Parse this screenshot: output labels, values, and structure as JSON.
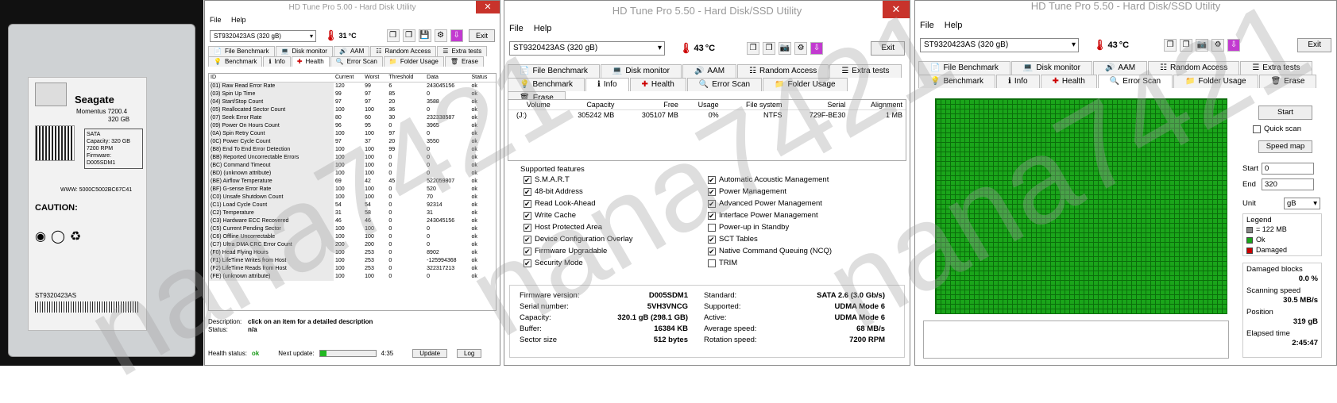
{
  "drive_photo": {
    "brand": "Seagate",
    "model_line": "Momentus 7200.4",
    "capacity": "320 GB",
    "sticker_lines": [
      "SATA",
      "Capacity: 320 GB",
      "7200 RPM",
      "Firmware: D005SDM1"
    ],
    "serial_text": "ST9320423AS",
    "caution": "CAUTION:",
    "www": "WWW: 5000C5002BC67C41"
  },
  "watermark": "nana7421",
  "window1": {
    "title": "HD Tune Pro 5.00 - Hard Disk Utility",
    "menu": [
      "File",
      "Help"
    ],
    "drive": "ST9320423AS     (320 gB)",
    "temperature": "31",
    "temp_unit": "°C",
    "exit": "Exit",
    "tabs_row1": [
      "File Benchmark",
      "Disk monitor",
      "AAM",
      "Random Access",
      "Extra tests"
    ],
    "tabs_row2": [
      "Benchmark",
      "Info",
      "Health",
      "Error Scan",
      "Folder Usage",
      "Erase"
    ],
    "health_headers": [
      "ID",
      "Current",
      "Worst",
      "Threshold",
      "Data",
      "Status"
    ],
    "health_rows": [
      [
        "(01) Raw Read Error Rate",
        "120",
        "99",
        "6",
        "243045156",
        "ok"
      ],
      [
        "(03) Spin Up Time",
        "99",
        "97",
        "85",
        "0",
        "ok"
      ],
      [
        "(04) Start/Stop Count",
        "97",
        "97",
        "20",
        "3588",
        "ok"
      ],
      [
        "(05) Reallocated Sector Count",
        "100",
        "100",
        "36",
        "0",
        "ok"
      ],
      [
        "(07) Seek Error Rate",
        "80",
        "60",
        "30",
        "232338587",
        "ok"
      ],
      [
        "(09) Power On Hours Count",
        "96",
        "95",
        "0",
        "3965",
        "ok"
      ],
      [
        "(0A) Spin Retry Count",
        "100",
        "100",
        "97",
        "0",
        "ok"
      ],
      [
        "(0C) Power Cycle Count",
        "97",
        "37",
        "20",
        "3550",
        "ok"
      ],
      [
        "(B8) End To End Error Detection",
        "100",
        "100",
        "99",
        "0",
        "ok"
      ],
      [
        "(BB) Reported Uncorrectable Errors",
        "100",
        "100",
        "0",
        "0",
        "ok"
      ],
      [
        "(BC) Command Timeout",
        "100",
        "100",
        "0",
        "0",
        "ok"
      ],
      [
        "(BD) (unknown attribute)",
        "100",
        "100",
        "0",
        "0",
        "ok"
      ],
      [
        "(BE) Airflow Temperature",
        "69",
        "42",
        "45",
        "522059807",
        "ok"
      ],
      [
        "(BF) G-sense Error Rate",
        "100",
        "100",
        "0",
        "520",
        "ok"
      ],
      [
        "(C0) Unsafe Shutdown Count",
        "100",
        "100",
        "0",
        "70",
        "ok"
      ],
      [
        "(C1) Load Cycle Count",
        "54",
        "54",
        "0",
        "92314",
        "ok"
      ],
      [
        "(C2) Temperature",
        "31",
        "58",
        "0",
        "31",
        "ok"
      ],
      [
        "(C3) Hardware ECC Recovered",
        "46",
        "46",
        "0",
        "243045156",
        "ok"
      ],
      [
        "(C5) Current Pending Sector",
        "100",
        "100",
        "0",
        "0",
        "ok"
      ],
      [
        "(C6) Offline Uncorrectable",
        "100",
        "100",
        "0",
        "0",
        "ok"
      ],
      [
        "(C7) Ultra DMA CRC Error Count",
        "200",
        "200",
        "0",
        "0",
        "ok"
      ],
      [
        "(F0) Head Flying Hours",
        "100",
        "253",
        "0",
        "8902",
        "ok"
      ],
      [
        "(F1) LifeTime Writes from Host",
        "100",
        "253",
        "0",
        "-125994368",
        "ok"
      ],
      [
        "(F2) LifeTime Reads from Host",
        "100",
        "253",
        "0",
        "322317213",
        "ok"
      ],
      [
        "(FE) (unknown attribute)",
        "100",
        "100",
        "0",
        "0",
        "ok"
      ]
    ],
    "description_label": "Description:",
    "description_value": "click on an item for a detailed description",
    "status_label": "Status:",
    "status_value": "n/a",
    "health_status_label": "Health status:",
    "health_status_value": "ok",
    "next_update_label": "Next update:",
    "next_update_value": "4:35",
    "next_update_progress": 0.12,
    "update_btn": "Update",
    "log_btn": "Log"
  },
  "window2": {
    "title": "HD Tune Pro 5.50 - Hard Disk/SSD Utility",
    "menu": [
      "File",
      "Help"
    ],
    "drive": "ST9320423AS (320 gB)",
    "temperature": "43",
    "temp_unit": "°C",
    "exit": "Exit",
    "tabs_row1": [
      "File Benchmark",
      "Disk monitor",
      "AAM",
      "Random Access",
      "Extra tests"
    ],
    "tabs_row2": [
      "Benchmark",
      "Info",
      "Health",
      "Error Scan",
      "Folder Usage",
      "Erase"
    ],
    "vol_headers": [
      "Volume",
      "Capacity",
      "Free",
      "Usage",
      "File system",
      "Serial",
      "Alignment"
    ],
    "vol_row": [
      "(J:)",
      "305242 MB",
      "305107 MB",
      "0%",
      "NTFS",
      "729F-BE30",
      "1 MB"
    ],
    "features_label": "Supported features",
    "features_left": [
      {
        "name": "S.M.A.R.T",
        "on": true
      },
      {
        "name": "48-bit Address",
        "on": true
      },
      {
        "name": "Read Look-Ahead",
        "on": true
      },
      {
        "name": "Write Cache",
        "on": true
      },
      {
        "name": "Host Protected Area",
        "on": true
      },
      {
        "name": "Device Configuration Overlay",
        "on": true
      },
      {
        "name": "Firmware Upgradable",
        "on": true
      },
      {
        "name": "Security Mode",
        "on": true
      }
    ],
    "features_right": [
      {
        "name": "Automatic Acoustic Management",
        "on": true
      },
      {
        "name": "Power Management",
        "on": true
      },
      {
        "name": "Advanced Power Management",
        "on": true
      },
      {
        "name": "Interface Power Management",
        "on": true
      },
      {
        "name": "Power-up in Standby",
        "on": false
      },
      {
        "name": "SCT Tables",
        "on": true
      },
      {
        "name": "Native Command Queuing (NCQ)",
        "on": true
      },
      {
        "name": "TRIM",
        "on": false
      }
    ],
    "details_left": [
      [
        "Firmware version:",
        "D005SDM1"
      ],
      [
        "Serial number:",
        "5VH3VNCG"
      ],
      [
        "Capacity:",
        "320.1 gB (298.1 GB)"
      ],
      [
        "Buffer:",
        "16384 KB"
      ],
      [
        "Sector size",
        "512 bytes"
      ]
    ],
    "details_right": [
      [
        "Standard:",
        "SATA 2.6 (3.0 Gb/s)"
      ],
      [
        "Supported:",
        "UDMA Mode 6"
      ],
      [
        "Active:",
        "UDMA Mode 6"
      ],
      [
        "Average speed:",
        "68 MB/s"
      ],
      [
        "Rotation speed:",
        "7200 RPM"
      ]
    ]
  },
  "window3": {
    "title": "HD Tune Pro 5.50 - Hard Disk/SSD Utility",
    "menu": [
      "File",
      "Help"
    ],
    "drive": "ST9320423AS (320 gB)",
    "temperature": "43",
    "temp_unit": "°C",
    "exit": "Exit",
    "tabs_row1": [
      "File Benchmark",
      "Disk monitor",
      "AAM",
      "Random Access",
      "Extra tests"
    ],
    "tabs_row2": [
      "Benchmark",
      "Info",
      "Health",
      "Error Scan",
      "Folder Usage",
      "Erase"
    ],
    "start_btn": "Start",
    "quick_scan": "Quick scan",
    "speed_map": "Speed map",
    "start_label": "Start",
    "start_value": "0",
    "end_label": "End",
    "end_value": "320",
    "unit_label": "Unit",
    "unit_value": "gB",
    "legend_title": "Legend",
    "legend_items": [
      {
        "label": "= 122 MB",
        "color": "#888888"
      },
      {
        "label": "Ok",
        "color": "#1aa51a"
      },
      {
        "label": "Damaged",
        "color": "#cc0000"
      }
    ],
    "damaged_blocks_label": "Damaged blocks",
    "damaged_blocks_value": "0.0 %",
    "scanning_speed_label": "Scanning speed",
    "scanning_speed_value": "30.5 MB/s",
    "position_label": "Position",
    "position_value": "319 gB",
    "elapsed_label": "Elapsed time",
    "elapsed_value": "2:45:47"
  }
}
